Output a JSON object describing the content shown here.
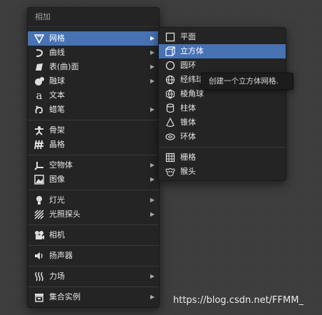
{
  "main_menu": {
    "title": "相加",
    "items": [
      {
        "label": "网格",
        "icon": "mesh-icon",
        "submenu": true,
        "active": true
      },
      {
        "label": "曲线",
        "icon": "curve-icon",
        "submenu": true
      },
      {
        "label": "表(曲)面",
        "icon": "surface-icon",
        "submenu": true
      },
      {
        "label": "融球",
        "icon": "metaball-icon",
        "submenu": true
      },
      {
        "label": "文本",
        "icon": "text-icon",
        "submenu": false
      },
      {
        "label": "蜡笔",
        "icon": "grease-pencil-icon",
        "submenu": true
      },
      {
        "label": "骨架",
        "icon": "armature-icon",
        "submenu": false
      },
      {
        "label": "晶格",
        "icon": "lattice-icon",
        "submenu": false
      },
      {
        "label": "空物体",
        "icon": "empty-icon",
        "submenu": true
      },
      {
        "label": "图像",
        "icon": "image-icon",
        "submenu": true
      },
      {
        "label": "灯光",
        "icon": "light-icon",
        "submenu": true
      },
      {
        "label": "光照探头",
        "icon": "light-probe-icon",
        "submenu": true
      },
      {
        "label": "相机",
        "icon": "camera-icon",
        "submenu": false
      },
      {
        "label": "扬声器",
        "icon": "speaker-icon",
        "submenu": false
      },
      {
        "label": "力场",
        "icon": "force-field-icon",
        "submenu": true
      },
      {
        "label": "集合实例",
        "icon": "collection-instance-icon",
        "submenu": true
      }
    ]
  },
  "sub_menu": {
    "items": [
      {
        "label": "平面",
        "icon": "plane-icon"
      },
      {
        "label": "立方体",
        "icon": "cube-icon",
        "active": true
      },
      {
        "label": "圆环",
        "icon": "circle-icon"
      },
      {
        "label": "经纬球",
        "icon": "uv-sphere-icon"
      },
      {
        "label": "棱角球",
        "icon": "ico-sphere-icon"
      },
      {
        "label": "柱体",
        "icon": "cylinder-icon"
      },
      {
        "label": "锥体",
        "icon": "cone-icon"
      },
      {
        "label": "环体",
        "icon": "torus-icon"
      },
      {
        "label": "栅格",
        "icon": "grid-icon"
      },
      {
        "label": "猴头",
        "icon": "monkey-icon"
      }
    ]
  },
  "tooltip": {
    "text": "创建一个立方体网格."
  },
  "watermark": {
    "text": "https://blog.csdn.net/FFMM_"
  },
  "colors": {
    "accent": "#4772b3",
    "menu_bg": "#242424",
    "background": "#3d3d3d"
  }
}
